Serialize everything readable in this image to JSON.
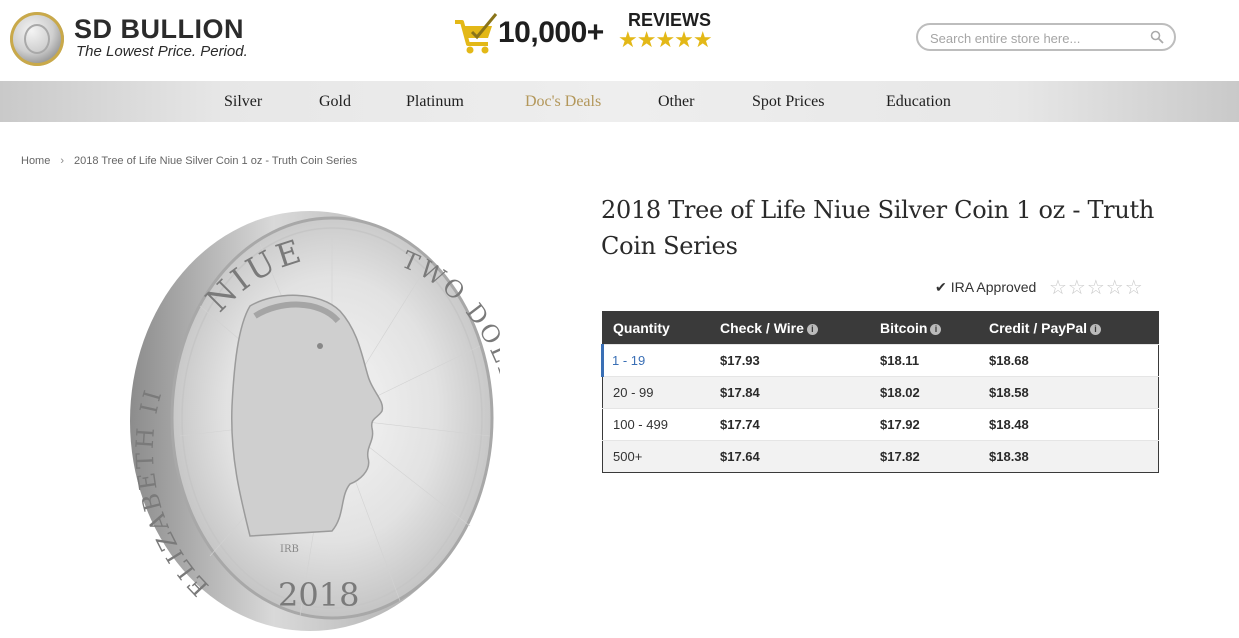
{
  "header": {
    "logo_title": "SD BULLION",
    "logo_tagline": "The Lowest Price. Period.",
    "reviews_count": "10,000+",
    "reviews_label": "REVIEWS",
    "reviews_stars": "★★★★★",
    "search_placeholder": "Search entire store here..."
  },
  "nav": {
    "items": [
      "Silver",
      "Gold",
      "Platinum",
      "Doc's Deals",
      "Other",
      "Spot Prices",
      "Education"
    ]
  },
  "breadcrumb": {
    "home": "Home",
    "separator": "›",
    "current": "2018 Tree of Life Niue Silver Coin 1 oz - Truth Coin Series"
  },
  "product": {
    "title": "2018 Tree of Life Niue Silver Coin 1 oz - Truth Coin Series",
    "ira_label": "IRA Approved",
    "rating_stars": "☆☆☆☆☆",
    "coin_text": {
      "top": "NIUE",
      "left": "ELIZABETH II",
      "right": "TWO DOLLARS",
      "year": "2018",
      "initials": "IRB"
    }
  },
  "price_table": {
    "headers": [
      "Quantity",
      "Check / Wire",
      "Bitcoin",
      "Credit / PayPal"
    ],
    "rows": [
      [
        "1 - 19",
        "$17.93",
        "$18.11",
        "$18.68"
      ],
      [
        "20 - 99",
        "$17.84",
        "$18.02",
        "$18.58"
      ],
      [
        "100 - 499",
        "$17.74",
        "$17.92",
        "$18.48"
      ],
      [
        "500+",
        "$17.64",
        "$17.82",
        "$18.38"
      ]
    ]
  },
  "colors": {
    "table_header_bg": "#3a3a3a",
    "active_qty": "#3a6fb5",
    "deals_nav": "#b3975a",
    "star_gold": "#e3b817"
  }
}
